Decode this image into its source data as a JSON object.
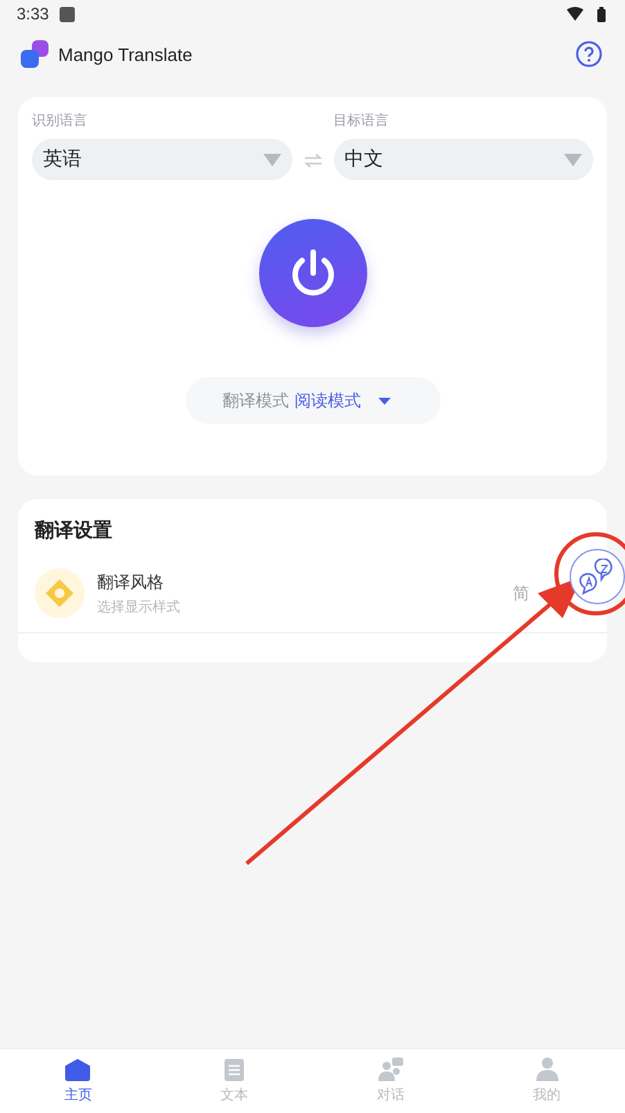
{
  "status_bar": {
    "time": "3:33"
  },
  "app_bar": {
    "title": "Mango Translate"
  },
  "languages": [
    {
      "label": "识别语言",
      "value": "英语"
    },
    {
      "label": "目标语言",
      "value": "中文"
    }
  ],
  "power": {
    "on": true
  },
  "mode": {
    "label": "翻译模式",
    "value": "阅读模式"
  },
  "settings": {
    "title": "翻译设置",
    "items": [
      {
        "title": "翻译风格",
        "subtitle": "选择显示样式",
        "value": "简"
      }
    ]
  },
  "nav": [
    {
      "label": "主页",
      "selected": true,
      "kind": "home"
    },
    {
      "label": "文本",
      "selected": false,
      "kind": "text"
    },
    {
      "label": "对话",
      "selected": false,
      "kind": "chat"
    },
    {
      "label": "我的",
      "selected": false,
      "kind": "me"
    }
  ]
}
